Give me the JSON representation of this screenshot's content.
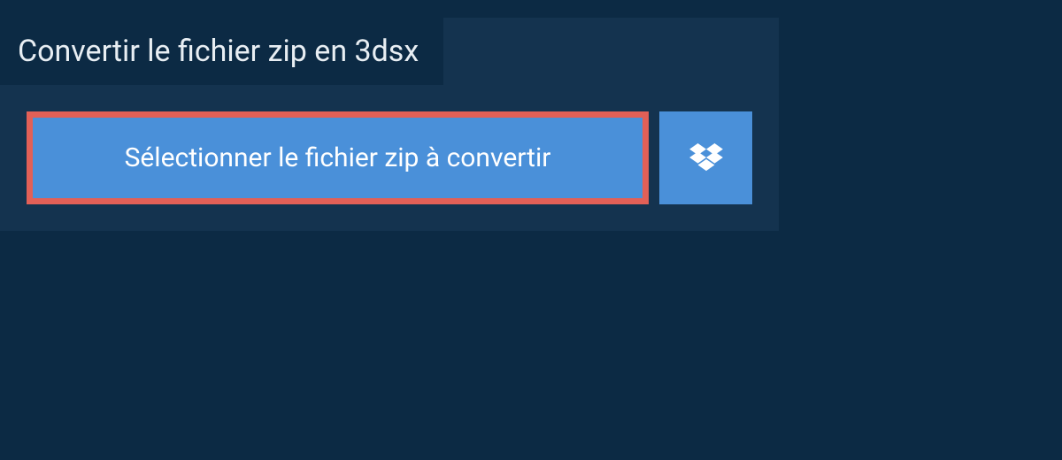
{
  "panel": {
    "title": "Convertir le fichier zip en 3dsx",
    "selectButton": {
      "label": "Sélectionner le fichier zip à convertir"
    }
  },
  "colors": {
    "background": "#0c2a44",
    "panel": "#14334f",
    "buttonBg": "#4a90d9",
    "buttonBorder": "#e26057",
    "text": "#e8eef3"
  }
}
